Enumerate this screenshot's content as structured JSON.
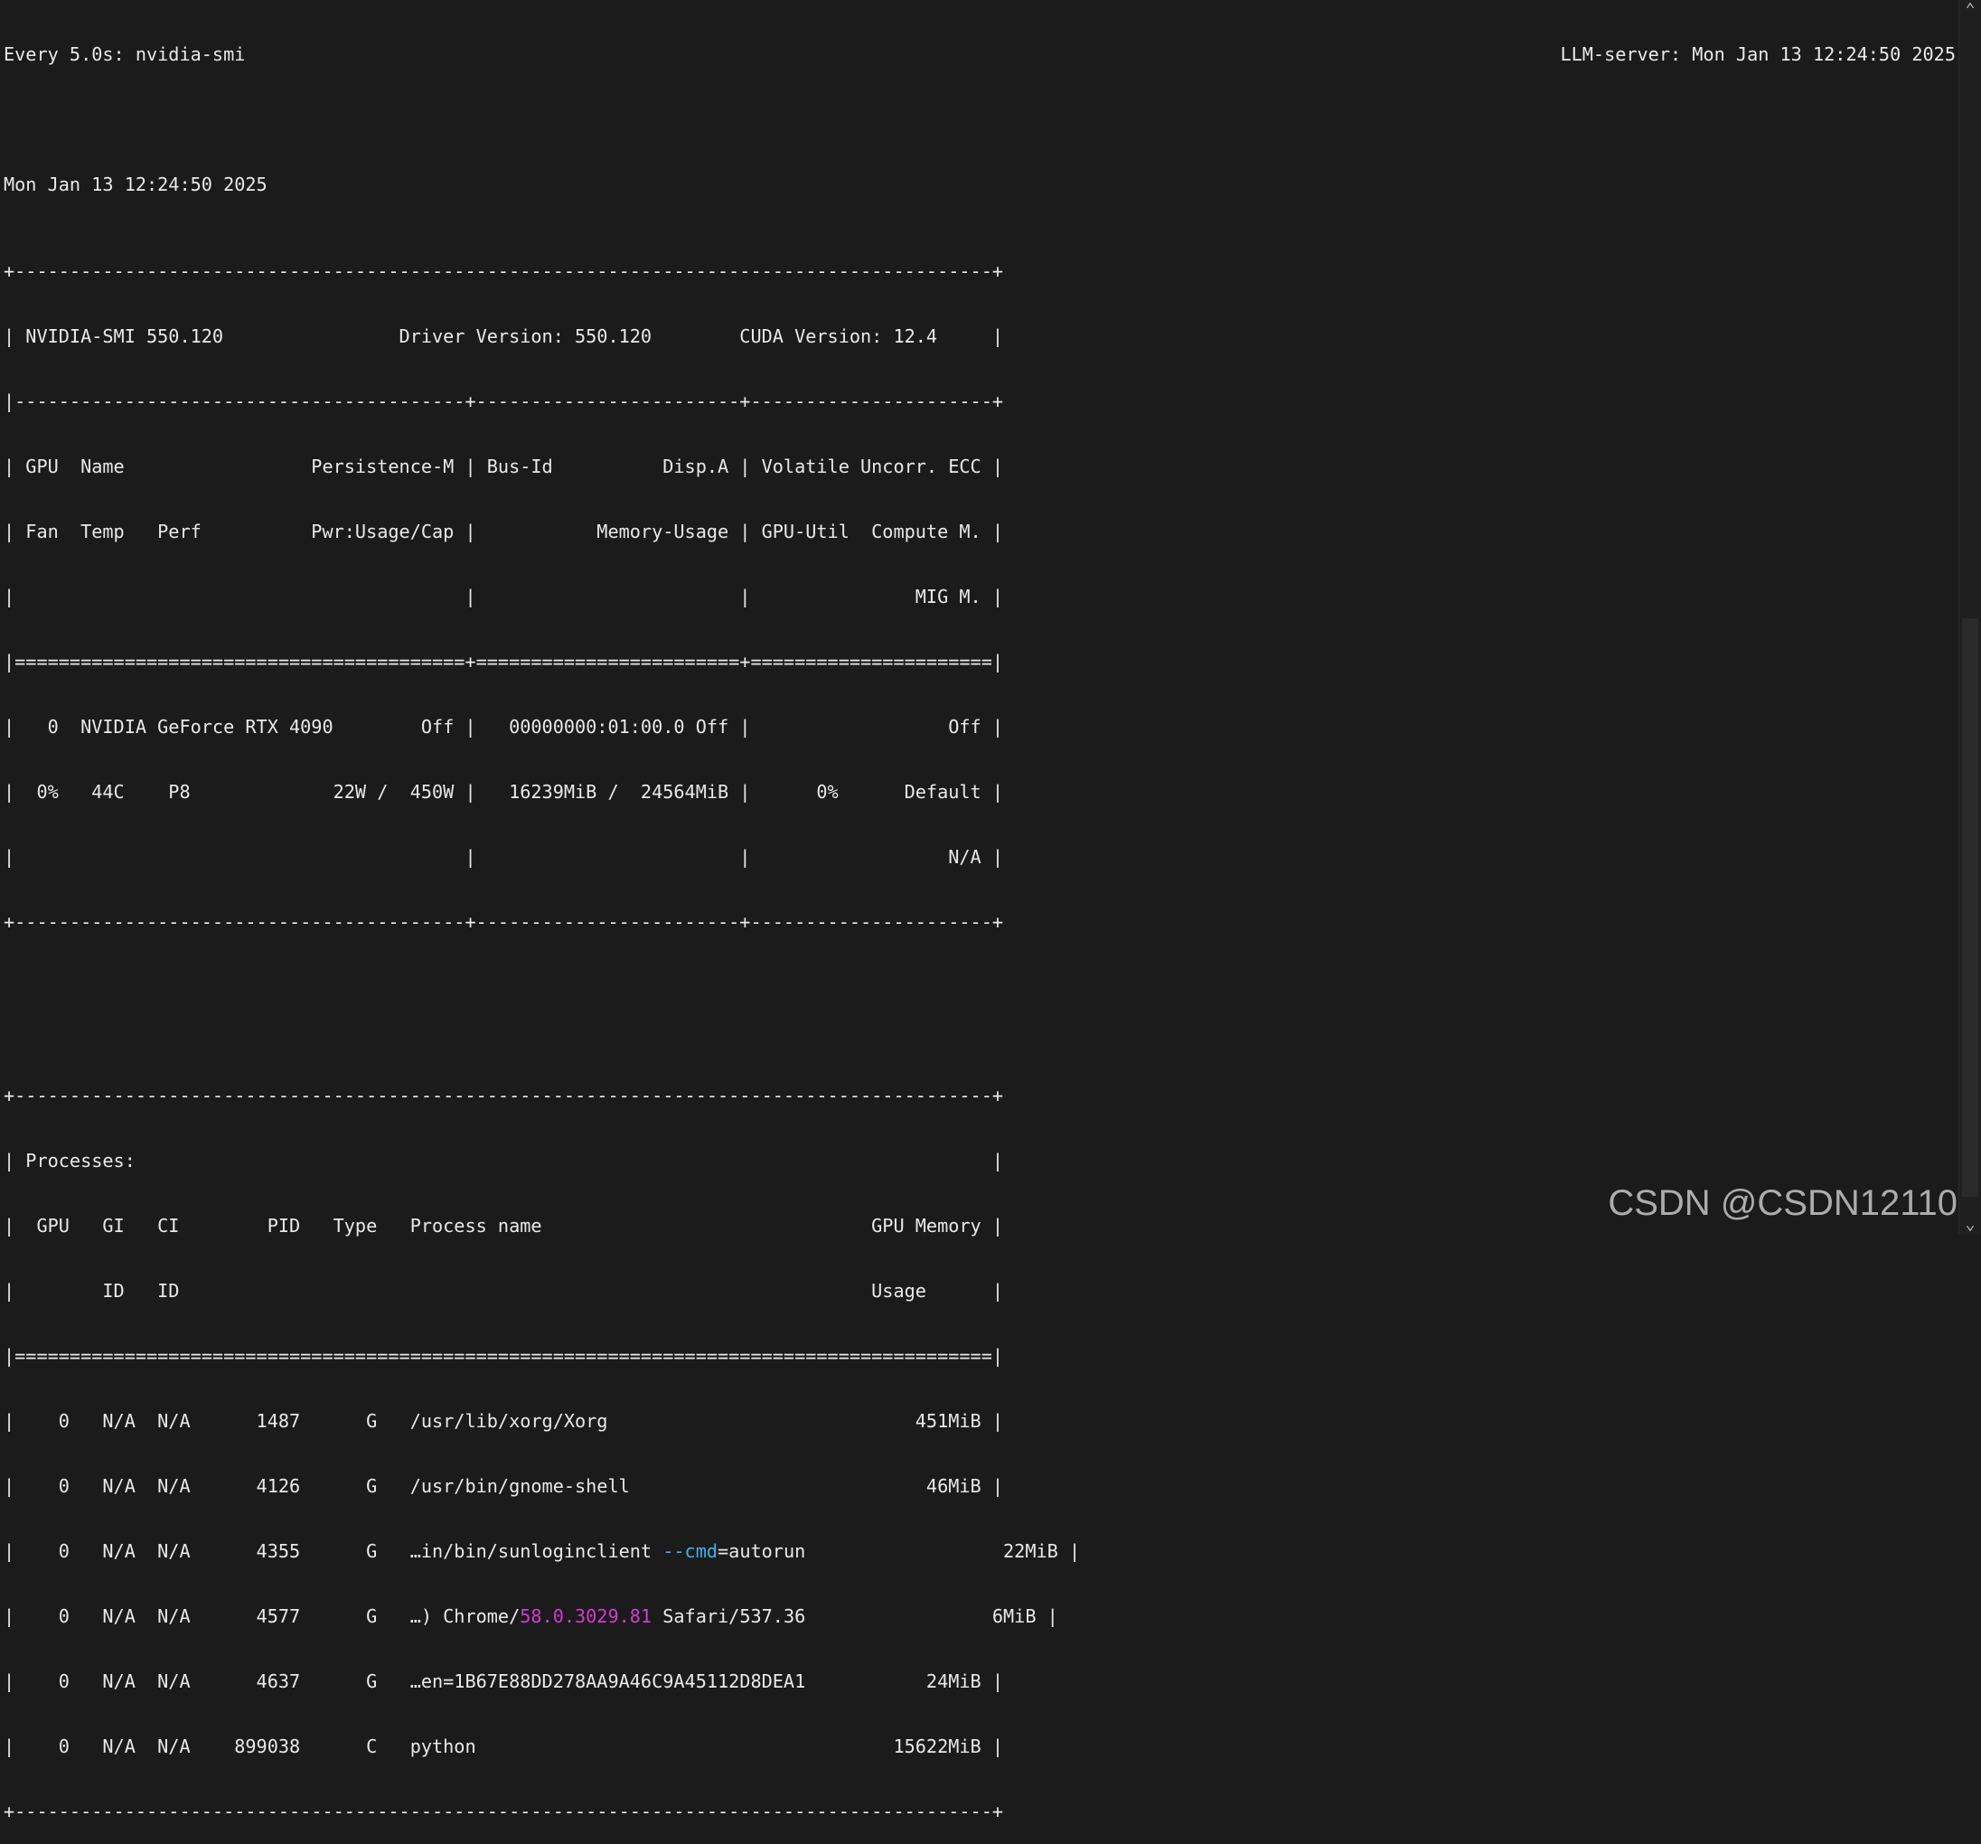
{
  "terminal": {
    "watch_header": "Every 5.0s: nvidia-smi",
    "host_time": "LLM-server: Mon Jan 13 12:24:50 2025",
    "timestamp": "Mon Jan 13 12:24:50 2025"
  },
  "smi": {
    "sep_top": "+-----------------------------------------------------------------------------------------+",
    "header": "| NVIDIA-SMI 550.120                Driver Version: 550.120        CUDA Version: 12.4     |",
    "sep_cols": "|-----------------------------------------+------------------------+----------------------+",
    "col_head_1": "| GPU  Name                 Persistence-M | Bus-Id          Disp.A | Volatile Uncorr. ECC |",
    "col_head_2": "| Fan  Temp   Perf          Pwr:Usage/Cap |           Memory-Usage | GPU-Util  Compute M. |",
    "col_head_3": "|                                         |                        |               MIG M. |",
    "sep_eq": "|=========================================+========================+======================|",
    "gpu_row_1": "|   0  NVIDIA GeForce RTX 4090        Off |   00000000:01:00.0 Off |                  Off |",
    "gpu_row_2": "|  0%   44C    P8             22W /  450W |   16239MiB /  24564MiB |      0%      Default |",
    "gpu_row_3": "|                                         |                        |                  N/A |",
    "sep_end": "+-----------------------------------------+------------------------+----------------------+"
  },
  "processes": {
    "sep_top": "+-----------------------------------------------------------------------------------------+",
    "title": "| Processes:                                                                              |",
    "head_1": "|  GPU   GI   CI        PID   Type   Process name                              GPU Memory |",
    "head_2": "|        ID   ID                                                               Usage      |",
    "sep_eq": "|=========================================================================================|",
    "row_1": "|    0   N/A  N/A      1487      G   /usr/lib/xorg/Xorg                            451MiB |",
    "row_2": "|    0   N/A  N/A      4126      G   /usr/bin/gnome-shell                           46MiB |",
    "row_3_pre": "|    0   N/A  N/A      4355      G   …in/bin/sunloginclient ",
    "row_3_flag": "--cmd",
    "row_3_post": "=autorun                  22MiB |",
    "row_4_pre": "|    0   N/A  N/A      4577      G   …) Chrome/",
    "row_4_ver": "58.0.3029.81",
    "row_4_post": " Safari/537.36                 6MiB |",
    "row_5": "|    0   N/A  N/A      4637      G   …en=1B67E88DD278AA9A46C9A45112D8DEA1           24MiB |",
    "row_6": "|    0   N/A  N/A    899038      C   python                                      15622MiB |",
    "sep_end": "+-----------------------------------------------------------------------------------------+"
  },
  "watermark": "CSDN @CSDN12110",
  "icons": {
    "scroll_up": "chevron-up-icon",
    "scroll_down": "chevron-down-icon"
  },
  "colors": {
    "background": "#1b1b1b",
    "text": "#e9e9e9",
    "highlight_cyan": "#3fb3e8",
    "highlight_magenta": "#d33bd3"
  }
}
